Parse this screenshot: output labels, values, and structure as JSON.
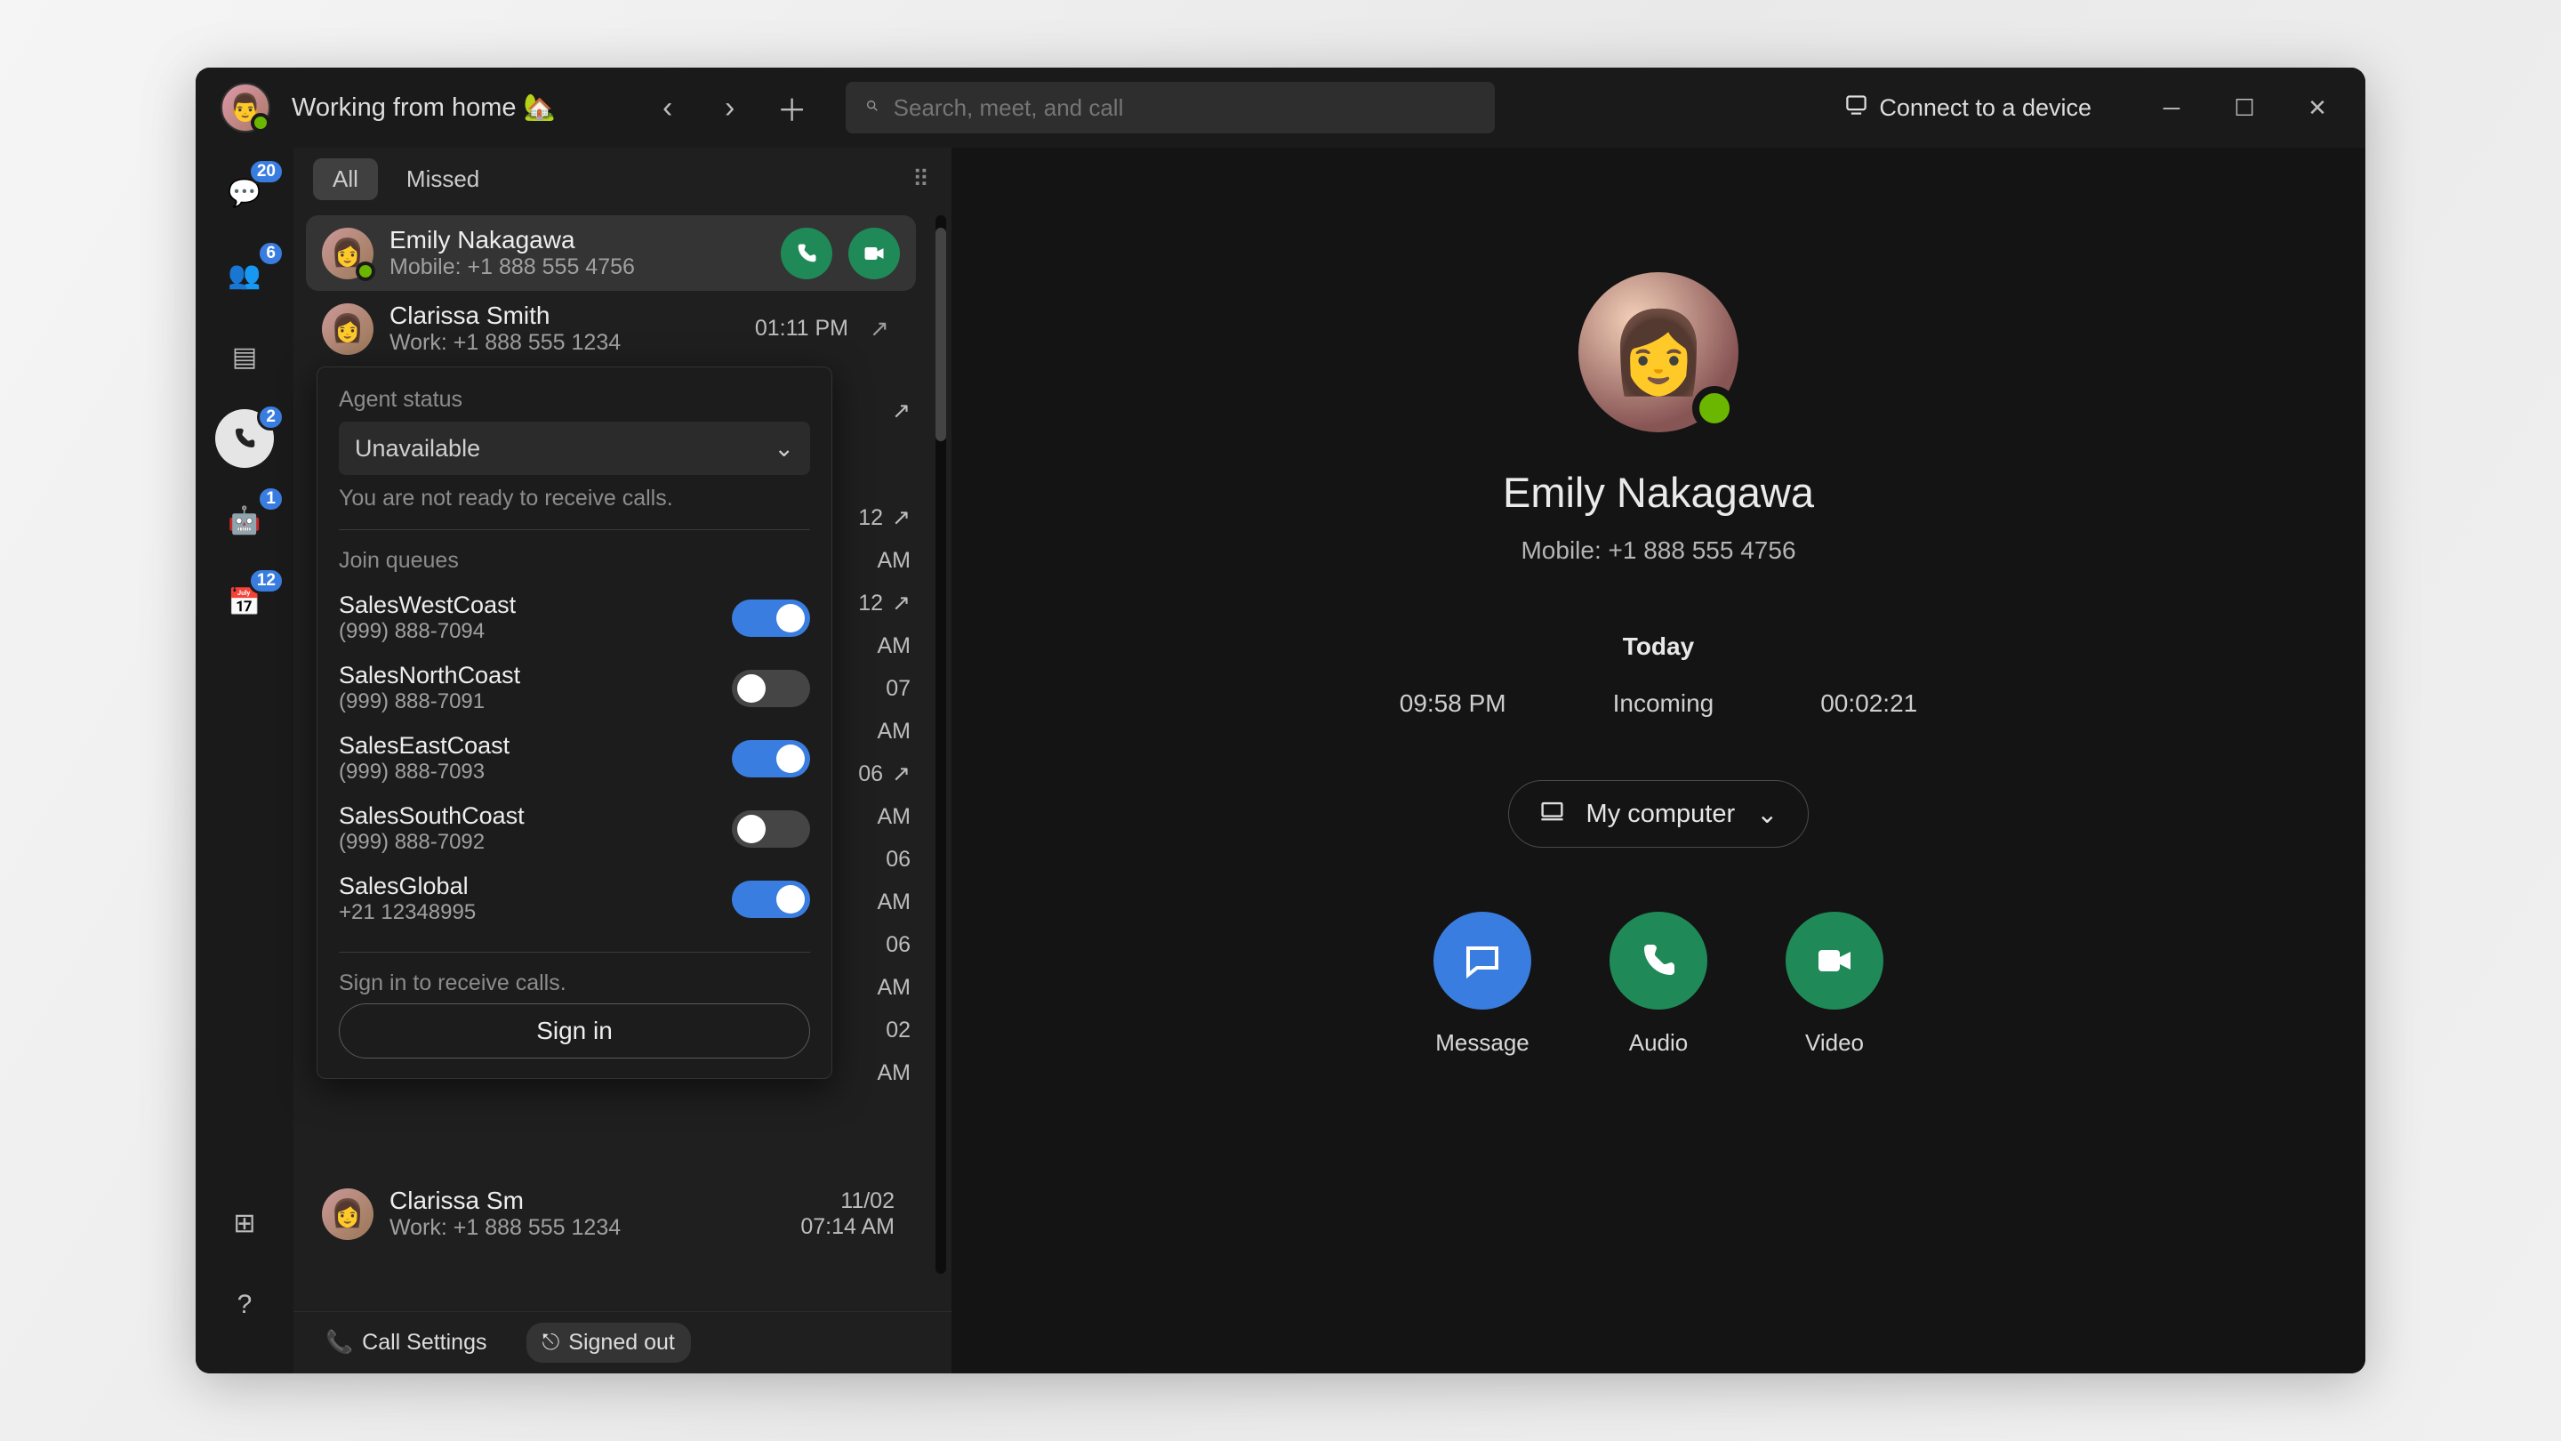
{
  "titlebar": {
    "status": "Working from home 🏡",
    "search_placeholder": "Search, meet, and call",
    "connect": "Connect to a device"
  },
  "rail": {
    "items": [
      {
        "icon": "chat-icon",
        "badge": "20"
      },
      {
        "icon": "teams-icon",
        "badge": "6"
      },
      {
        "icon": "calendar2-icon",
        "badge": ""
      },
      {
        "icon": "calls-icon",
        "badge": "2",
        "active": true
      },
      {
        "icon": "bot-icon",
        "badge": "1"
      },
      {
        "icon": "calendar-icon",
        "badge": "12"
      }
    ],
    "apps_icon": "apps-icon",
    "help_icon": "help-icon"
  },
  "tabs": {
    "all": "All",
    "missed": "Missed"
  },
  "calls": [
    {
      "name": "Emily Nakagawa",
      "sub": "Mobile: +1 888 555 4756",
      "time": "",
      "selected": true
    },
    {
      "name": "Clarissa Smith",
      "sub": "Work: +1 888 555 1234",
      "time": "01:11 PM"
    },
    {
      "name": "",
      "sub": "",
      "time": ""
    },
    {
      "name": "",
      "sub": "",
      "time": "12"
    },
    {
      "name": "",
      "sub": "",
      "time": "AM"
    },
    {
      "name": "",
      "sub": "",
      "time": "12"
    },
    {
      "name": "",
      "sub": "",
      "time": "AM"
    },
    {
      "name": "",
      "sub": "",
      "time": "07"
    },
    {
      "name": "",
      "sub": "",
      "time": "AM"
    },
    {
      "name": "",
      "sub": "",
      "time": "06"
    },
    {
      "name": "",
      "sub": "",
      "time": "AM"
    },
    {
      "name": "",
      "sub": "",
      "time": "06"
    },
    {
      "name": "",
      "sub": "",
      "time": "AM"
    },
    {
      "name": "",
      "sub": "",
      "time": "06"
    },
    {
      "name": "",
      "sub": "",
      "time": "AM"
    },
    {
      "name": "",
      "sub": "",
      "time": "02"
    },
    {
      "name": "",
      "sub": "",
      "time": "AM"
    },
    {
      "name": "Clarissa Sm",
      "sub": "Work: +1 888 555 1234",
      "time": "11/02"
    },
    {
      "name": "",
      "sub": "",
      "time": "07:14 AM"
    }
  ],
  "popup": {
    "agent_label": "Agent status",
    "status_value": "Unavailable",
    "hint": "You are not ready to receive calls.",
    "join_label": "Join queues",
    "queues": [
      {
        "name": "SalesWestCoast",
        "phone": "(999) 888-7094",
        "on": true
      },
      {
        "name": "SalesNorthCoast",
        "phone": "(999) 888-7091",
        "on": false
      },
      {
        "name": "SalesEastCoast",
        "phone": "(999) 888-7093",
        "on": true
      },
      {
        "name": "SalesSouthCoast",
        "phone": "(999) 888-7092",
        "on": false
      },
      {
        "name": "SalesGlobal",
        "phone": "+21 12348995",
        "on": true
      }
    ],
    "signin_hint": "Sign in to receive calls.",
    "signin": "Sign in"
  },
  "footer": {
    "settings": "Call Settings",
    "signed": "Signed out"
  },
  "main": {
    "name": "Emily Nakagawa",
    "sub": "Mobile: +1 888 555 4756",
    "today": "Today",
    "time": "09:58 PM",
    "dir": "Incoming",
    "dur": "00:02:21",
    "device": "My computer",
    "msg": "Message",
    "audio": "Audio",
    "video": "Video"
  }
}
